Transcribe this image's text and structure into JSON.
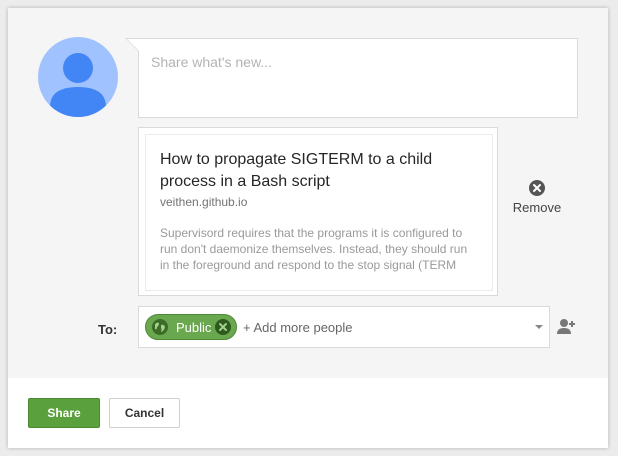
{
  "composer": {
    "placeholder": "Share what's new..."
  },
  "link_preview": {
    "title": "How to propagate SIGTERM to a child process in a Bash script",
    "domain": "veithen.github.io",
    "description": "Supervisord requires that the programs it is configured to run don't daemonize themselves. Instead, they should run in the foreground and respond to the stop signal (TERM"
  },
  "remove": {
    "label": "Remove",
    "icon": "close-circle-icon"
  },
  "audience": {
    "to_label": "To:",
    "chip_label": "Public",
    "chip_icon": "globe-icon",
    "add_placeholder": "+ Add more people",
    "add_person_icon": "add-person-icon"
  },
  "footer": {
    "share_label": "Share",
    "cancel_label": "Cancel"
  },
  "colors": {
    "accent_green": "#5aa03c",
    "avatar_bg": "#a0c3ff",
    "avatar_fg": "#4285f4"
  }
}
